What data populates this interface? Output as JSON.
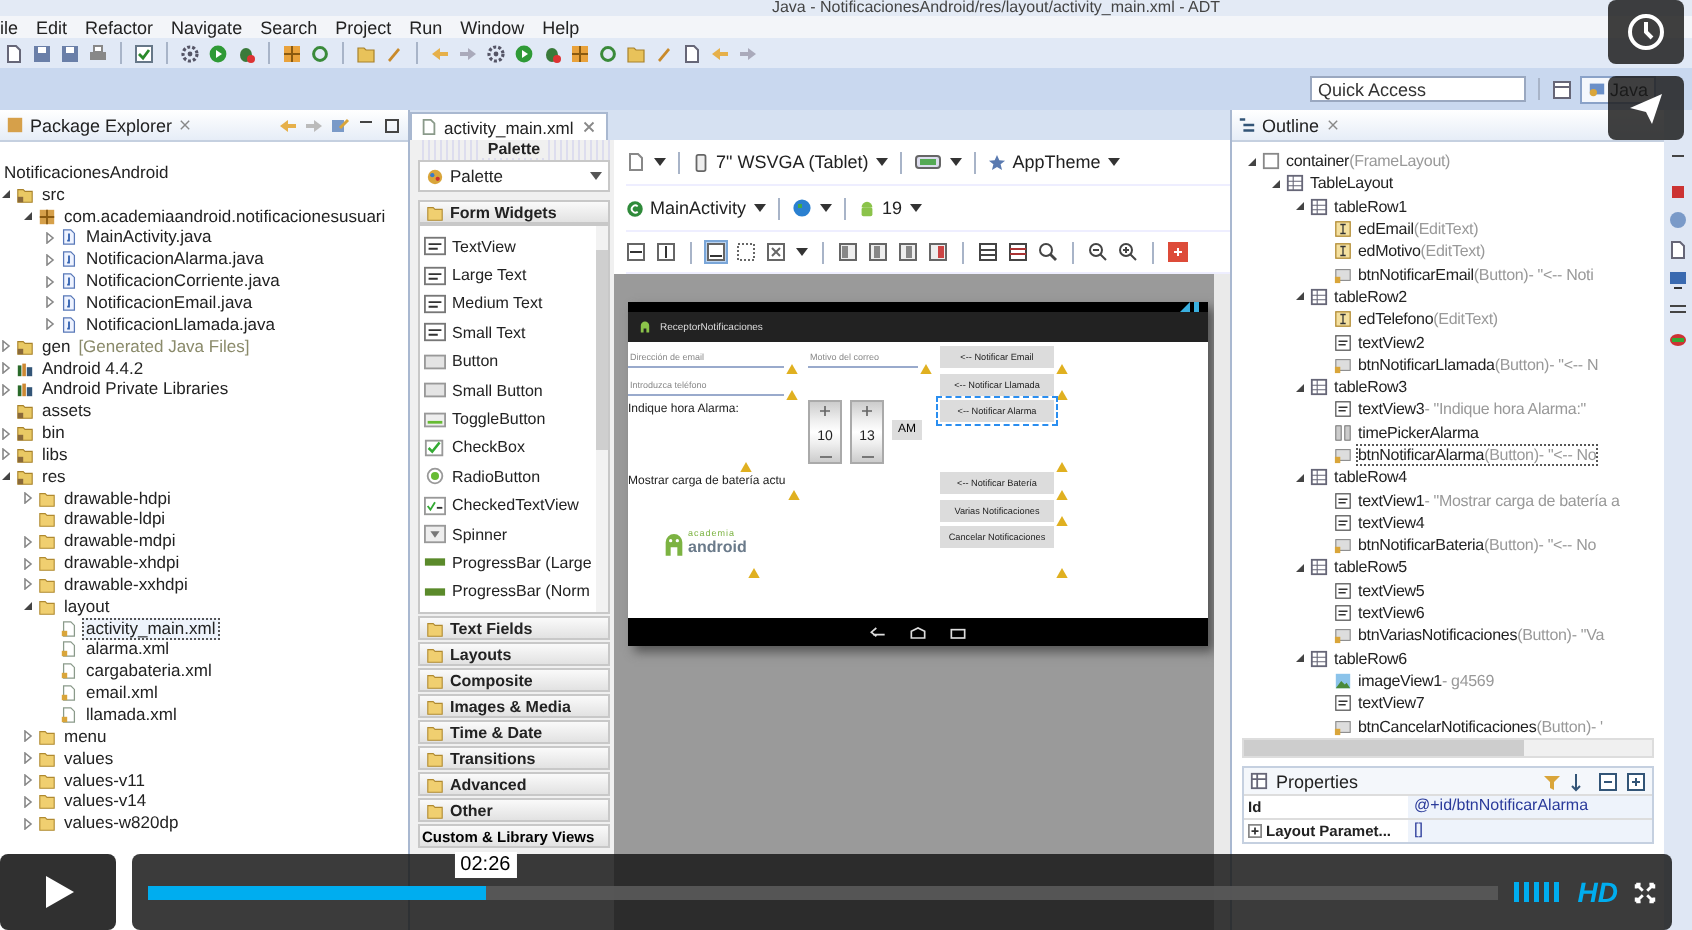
{
  "window": {
    "title": "Java - NotificacionesAndroid/res/layout/activity_main.xml - ADT"
  },
  "menu": [
    "ile",
    "Edit",
    "Refactor",
    "Navigate",
    "Search",
    "Project",
    "Run",
    "Window",
    "Help"
  ],
  "quick_access": {
    "placeholder": "Quick Access"
  },
  "perspectives": [
    {
      "label": "Java",
      "selected": true
    }
  ],
  "package_explorer": {
    "title": "Package Explorer",
    "project": "NotificacionesAndroid",
    "tree": [
      {
        "label": "src",
        "kind": "folder",
        "expanded": true,
        "selected": false,
        "children": [
          {
            "label": "com.academiaandroid.notificacionesusuari",
            "kind": "package",
            "expanded": true,
            "selected": false,
            "children": [
              {
                "label": "MainActivity.java",
                "kind": "java",
                "expanded": false,
                "selected": false
              },
              {
                "label": "NotificacionAlarma.java",
                "kind": "java",
                "expanded": false,
                "selected": false
              },
              {
                "label": "NotificacionCorriente.java",
                "kind": "java",
                "expanded": false,
                "selected": false
              },
              {
                "label": "NotificacionEmail.java",
                "kind": "java",
                "expanded": false,
                "selected": false
              },
              {
                "label": "NotificacionLlamada.java",
                "kind": "java",
                "expanded": false,
                "selected": false
              }
            ]
          }
        ]
      },
      {
        "label": "gen",
        "note": "[Generated Java Files]",
        "kind": "folder",
        "expanded": false,
        "selected": false
      },
      {
        "label": "Android 4.4.2",
        "kind": "library",
        "expanded": false,
        "selected": false
      },
      {
        "label": "Android Private Libraries",
        "kind": "library",
        "expanded": false,
        "selected": false
      },
      {
        "label": "assets",
        "kind": "folder",
        "selected": false
      },
      {
        "label": "bin",
        "kind": "folder",
        "expanded": false,
        "selected": false
      },
      {
        "label": "libs",
        "kind": "folder",
        "expanded": false,
        "selected": false
      },
      {
        "label": "res",
        "kind": "folder",
        "expanded": true,
        "selected": false,
        "children": [
          {
            "label": "drawable-hdpi",
            "kind": "dir",
            "expanded": false,
            "selected": false
          },
          {
            "label": "drawable-ldpi",
            "kind": "dir",
            "selected": false
          },
          {
            "label": "drawable-mdpi",
            "kind": "dir",
            "expanded": false,
            "selected": false
          },
          {
            "label": "drawable-xhdpi",
            "kind": "dir",
            "expanded": false,
            "selected": false
          },
          {
            "label": "drawable-xxhdpi",
            "kind": "dir",
            "expanded": false,
            "selected": false
          },
          {
            "label": "layout",
            "kind": "dir",
            "expanded": true,
            "selected": false,
            "children": [
              {
                "label": "activity_main.xml",
                "kind": "xml",
                "selected": true
              },
              {
                "label": "alarma.xml",
                "kind": "xml",
                "selected": false
              },
              {
                "label": "cargabateria.xml",
                "kind": "xml",
                "selected": false
              },
              {
                "label": "email.xml",
                "kind": "xml",
                "selected": false
              },
              {
                "label": "llamada.xml",
                "kind": "xml",
                "selected": false
              }
            ]
          },
          {
            "label": "menu",
            "kind": "dir",
            "expanded": false,
            "selected": false
          },
          {
            "label": "values",
            "kind": "dir",
            "expanded": false,
            "selected": false
          },
          {
            "label": "values-v11",
            "kind": "dir",
            "expanded": false,
            "selected": false
          },
          {
            "label": "values-v14",
            "kind": "dir",
            "expanded": false,
            "selected": false
          },
          {
            "label": "values-w820dp",
            "kind": "dir",
            "expanded": false,
            "selected": false
          }
        ]
      }
    ]
  },
  "editor_tab": {
    "label": "activity_main.xml"
  },
  "palette": {
    "title": "Palette",
    "dropdown": "Palette",
    "open_category": "Form Widgets",
    "widgets": [
      {
        "label": "TextView",
        "kind": "text"
      },
      {
        "label": "Large Text",
        "kind": "text"
      },
      {
        "label": "Medium Text",
        "kind": "text"
      },
      {
        "label": "Small Text",
        "kind": "text"
      },
      {
        "label": "Button",
        "kind": "button"
      },
      {
        "label": "Small Button",
        "kind": "button"
      },
      {
        "label": "ToggleButton",
        "kind": "toggle"
      },
      {
        "label": "CheckBox",
        "kind": "checkbox"
      },
      {
        "label": "RadioButton",
        "kind": "radio"
      },
      {
        "label": "CheckedTextView",
        "kind": "checkedtext"
      },
      {
        "label": "Spinner",
        "kind": "spinner"
      },
      {
        "label": "ProgressBar (Large",
        "kind": "progress"
      },
      {
        "label": "ProgressBar (Norm",
        "kind": "progress"
      }
    ],
    "categories": [
      "Text Fields",
      "Layouts",
      "Composite",
      "Images & Media",
      "Time & Date",
      "Transitions",
      "Advanced",
      "Other"
    ],
    "custom": "Custom & Library Views"
  },
  "designer": {
    "device": "7\" WSVGA (Tablet)",
    "theme": "AppTheme",
    "activity": "MainActivity",
    "api_level": "19",
    "app_title": "ReceptorNotificaciones",
    "rows": [
      {
        "cells": [
          {
            "kind": "field",
            "placeholder": "Dirección de email",
            "warning": true
          },
          {
            "kind": "field",
            "placeholder": "Motivo del correo",
            "warning": true
          },
          {
            "kind": "button",
            "text": "<-- Notificar Email",
            "warning": true,
            "selected": false
          }
        ]
      },
      {
        "cells": [
          {
            "kind": "field",
            "placeholder": "Introduzca teléfono",
            "warning": true
          },
          {
            "kind": "blank"
          },
          {
            "kind": "button",
            "text": "<-- Notificar Llamada",
            "warning": true,
            "selected": false
          }
        ]
      },
      {
        "cells": [
          {
            "kind": "label",
            "text": "Indique hora Alarma:",
            "warning": true
          },
          {
            "kind": "time-picker",
            "hour": "10",
            "minute": "13",
            "ampm": "AM"
          },
          {
            "kind": "button",
            "text": "<-- Notificar Alarma",
            "warning": true,
            "selected": true
          }
        ]
      },
      {
        "cells": [
          {
            "kind": "label",
            "text": "Mostrar carga de batería actu",
            "warning": true
          },
          {
            "kind": "blank"
          },
          {
            "kind": "button",
            "text": "<-- Notificar Batería",
            "warning": true,
            "selected": false
          }
        ]
      },
      {
        "cells": [
          {
            "kind": "blank"
          },
          {
            "kind": "blank"
          },
          {
            "kind": "button",
            "text": "Varias Notificaciones",
            "warning": true,
            "selected": false
          }
        ]
      },
      {
        "cells": [
          {
            "kind": "logo",
            "top": "academia",
            "bottom": "android",
            "warning": true
          },
          {
            "kind": "blank"
          },
          {
            "kind": "button",
            "text": "Cancelar Notificaciones",
            "warning": true,
            "selected": false
          }
        ]
      }
    ]
  },
  "outline": {
    "title": "Outline",
    "tree": [
      {
        "label": "container",
        "type": "(FrameLayout)",
        "kind": "frame",
        "expanded": true,
        "selected": false,
        "children": [
          {
            "label": "TableLayout",
            "kind": "table",
            "expanded": true,
            "selected": false,
            "children": [
              {
                "label": "tableRow1",
                "kind": "row",
                "expanded": true,
                "selected": false,
                "children": [
                  {
                    "label": "edEmail",
                    "type": "(EditText)",
                    "kind": "edit",
                    "selected": false
                  },
                  {
                    "label": "edMotivo",
                    "type": "(EditText)",
                    "kind": "edit",
                    "selected": false
                  },
                  {
                    "label": "btnNotificarEmail",
                    "type": "(Button)",
                    "detail": "- \"<-- Noti",
                    "kind": "button",
                    "selected": false
                  }
                ]
              },
              {
                "label": "tableRow2",
                "kind": "row",
                "expanded": true,
                "selected": false,
                "children": [
                  {
                    "label": "edTelefono",
                    "type": "(EditText)",
                    "kind": "edit",
                    "selected": false
                  },
                  {
                    "label": "textView2",
                    "kind": "text",
                    "selected": false
                  },
                  {
                    "label": "btnNotificarLlamada",
                    "type": "(Button)",
                    "detail": "- \"<-- N",
                    "kind": "button",
                    "selected": false
                  }
                ]
              },
              {
                "label": "tableRow3",
                "kind": "row",
                "expanded": true,
                "selected": false,
                "children": [
                  {
                    "label": "textView3",
                    "detail": "- \"Indique hora Alarma:\"",
                    "kind": "text",
                    "selected": false
                  },
                  {
                    "label": "timePickerAlarma",
                    "kind": "picker",
                    "selected": false
                  },
                  {
                    "label": "btnNotificarAlarma",
                    "type": "(Button)",
                    "detail": "- \"<-- No",
                    "kind": "button",
                    "selected": true
                  }
                ]
              },
              {
                "label": "tableRow4",
                "kind": "row",
                "expanded": true,
                "selected": false,
                "children": [
                  {
                    "label": "textView1",
                    "detail": "- \"Mostrar carga de batería a",
                    "kind": "text",
                    "selected": false
                  },
                  {
                    "label": "textView4",
                    "kind": "text",
                    "selected": false
                  },
                  {
                    "label": "btnNotificarBateria",
                    "type": "(Button)",
                    "detail": "- \"<-- No",
                    "kind": "button",
                    "selected": false
                  }
                ]
              },
              {
                "label": "tableRow5",
                "kind": "row",
                "expanded": true,
                "selected": false,
                "children": [
                  {
                    "label": "textView5",
                    "kind": "text",
                    "selected": false
                  },
                  {
                    "label": "textView6",
                    "kind": "text",
                    "selected": false
                  },
                  {
                    "label": "btnVariasNotificaciones",
                    "type": "(Button)",
                    "detail": "- \"Va",
                    "kind": "button",
                    "selected": false
                  }
                ]
              },
              {
                "label": "tableRow6",
                "kind": "row",
                "expanded": true,
                "selected": false,
                "children": [
                  {
                    "label": "imageView1",
                    "detail": "- g4569",
                    "kind": "image",
                    "selected": false
                  },
                  {
                    "label": "textView7",
                    "kind": "text",
                    "selected": false
                  },
                  {
                    "label": "btnCancelarNotificaciones",
                    "type": "(Button)",
                    "detail": "- '",
                    "kind": "button",
                    "selected": false
                  }
                ]
              }
            ]
          }
        ]
      }
    ]
  },
  "properties": {
    "title": "Properties",
    "rows": [
      {
        "name": "Id",
        "value": "@+id/btnNotificarAlarma"
      },
      {
        "name": "Layout Paramet...",
        "value": "[]",
        "expanded": false
      }
    ]
  },
  "player": {
    "time": "02:26",
    "level": 0.25,
    "quality": "HD"
  }
}
